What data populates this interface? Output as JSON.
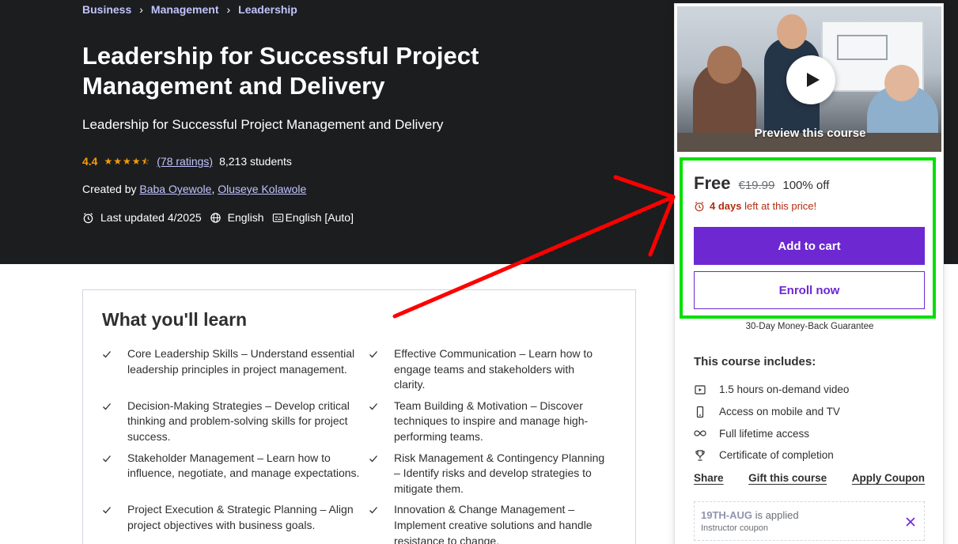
{
  "breadcrumb": [
    "Business",
    "Management",
    "Leadership"
  ],
  "course": {
    "title": "Leadership for Successful Project Management and Delivery",
    "subtitle": "Leadership for Successful Project Management and Delivery",
    "rating": "4.4",
    "rating_value": 4.4,
    "ratings_count": "(78 ratings)",
    "students": "8,213 students",
    "created_by_label": "Created by",
    "instructors": [
      "Baba Oyewole",
      "Oluseye Kolawole"
    ],
    "last_updated": "Last updated 4/2025",
    "language": "English",
    "captions": "English [Auto]"
  },
  "learn": {
    "title": "What you'll learn",
    "items": [
      "Core Leadership Skills – Understand essential leadership principles in project management.",
      "Effective Communication – Learn how to engage teams and stakeholders with clarity.",
      "Decision-Making Strategies – Develop critical thinking and problem-solving skills for project success.",
      "Team Building & Motivation – Discover techniques to inspire and manage high-performing teams.",
      "Stakeholder Management – Learn how to influence, negotiate, and manage expectations.",
      "Risk Management & Contingency Planning – Identify risks and develop strategies to mitigate them.",
      "Project Execution & Strategic Planning – Align project objectives with business goals.",
      "Innovation & Change Management – Implement creative solutions and handle resistance to change."
    ]
  },
  "card": {
    "preview_label": "Preview this course",
    "price": "Free",
    "original_price": "€19.99",
    "discount": "100% off",
    "timer_days": "4 days",
    "timer_rest": "left at this price!",
    "add_to_cart": "Add to cart",
    "enroll_now": "Enroll now",
    "guarantee": "30-Day Money-Back Guarantee",
    "includes_title": "This course includes:",
    "includes": [
      {
        "icon": "video-icon",
        "label": "1.5 hours on-demand video"
      },
      {
        "icon": "mobile-icon",
        "label": "Access on mobile and TV"
      },
      {
        "icon": "infinity-icon",
        "label": "Full lifetime access"
      },
      {
        "icon": "trophy-icon",
        "label": "Certificate of completion"
      }
    ],
    "links": {
      "share": "Share",
      "gift": "Gift this course",
      "coupon": "Apply Coupon"
    },
    "coupon": {
      "code": "19TH-AUG",
      "applied": "is applied",
      "type": "Instructor coupon"
    }
  },
  "colors": {
    "hero_bg": "#1c1d1f",
    "link_purple_light": "#c0c4fc",
    "star": "#f69c08",
    "primary": "#6d28d2",
    "timer_red": "#b32d0f",
    "annotation_green": "#00e000",
    "annotation_red": "#ff0000"
  }
}
